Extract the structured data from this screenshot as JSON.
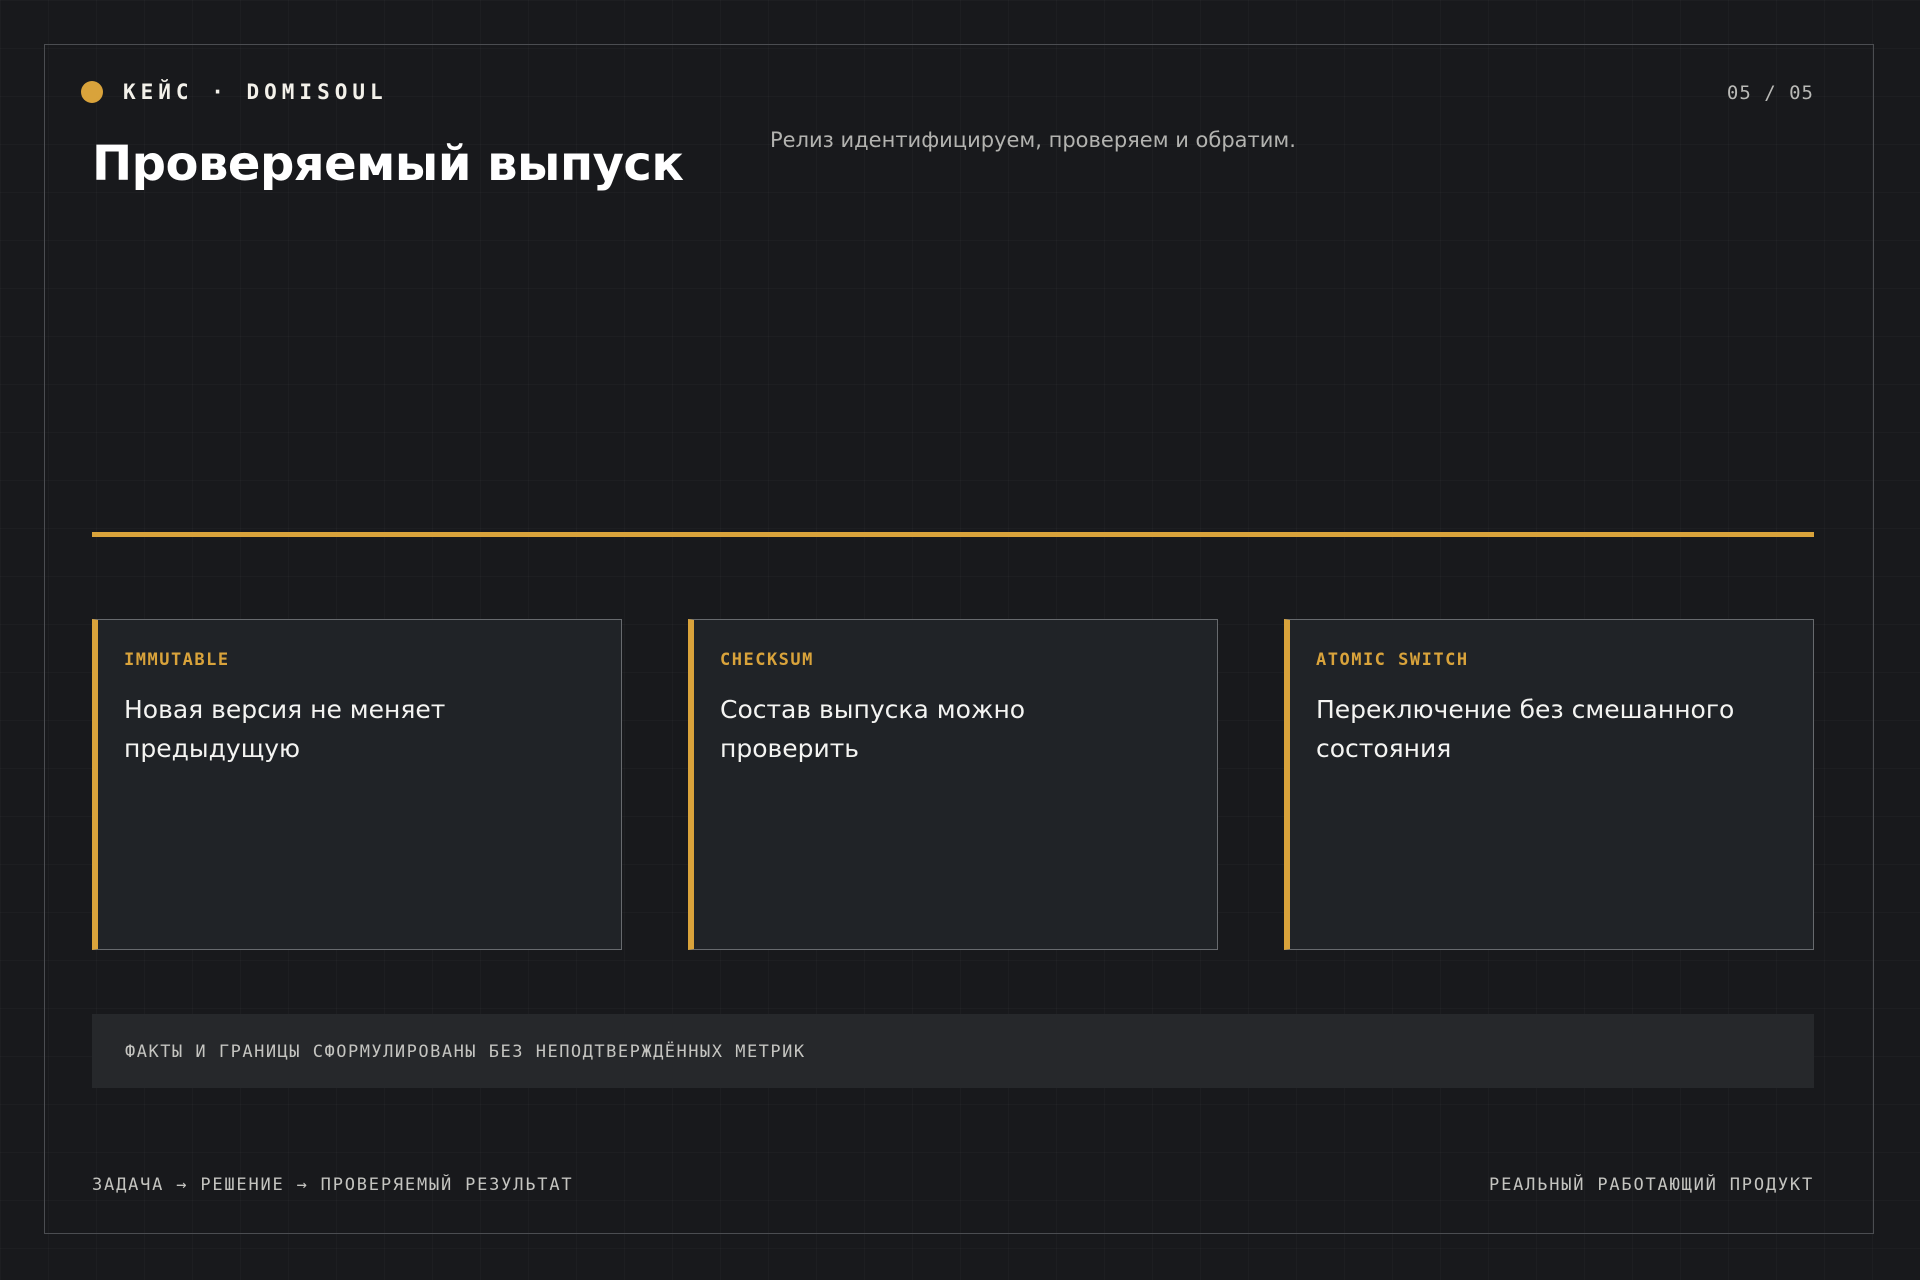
{
  "header": {
    "brand": "КЕЙС · DOMISOUL",
    "page_counter": "05 / 05",
    "title": "Проверяемый выпуск",
    "subtitle": "Релиз идентифицируем, проверяем и обратим."
  },
  "cards": [
    {
      "tag": "IMMUTABLE",
      "text": "Новая версия не меняет предыдущую"
    },
    {
      "tag": "CHECKSUM",
      "text": "Состав выпуска можно проверить"
    },
    {
      "tag": "ATOMIC SWITCH",
      "text": "Переключение без смешанного состояния"
    }
  ],
  "note": "ФАКТЫ И ГРАНИЦЫ СФОРМУЛИРОВАНЫ БЕЗ НЕПОДТВЕРЖДЁННЫХ МЕТРИК",
  "footer": {
    "left": "ЗАДАЧА → РЕШЕНИЕ → ПРОВЕРЯЕМЫЙ РЕЗУЛЬТАТ",
    "right": "РЕАЛЬНЫЙ РАБОТАЮЩИЙ ПРОДУКТ"
  },
  "colors": {
    "accent": "#d9a33b",
    "background": "#18191c",
    "card_background": "#202327"
  }
}
